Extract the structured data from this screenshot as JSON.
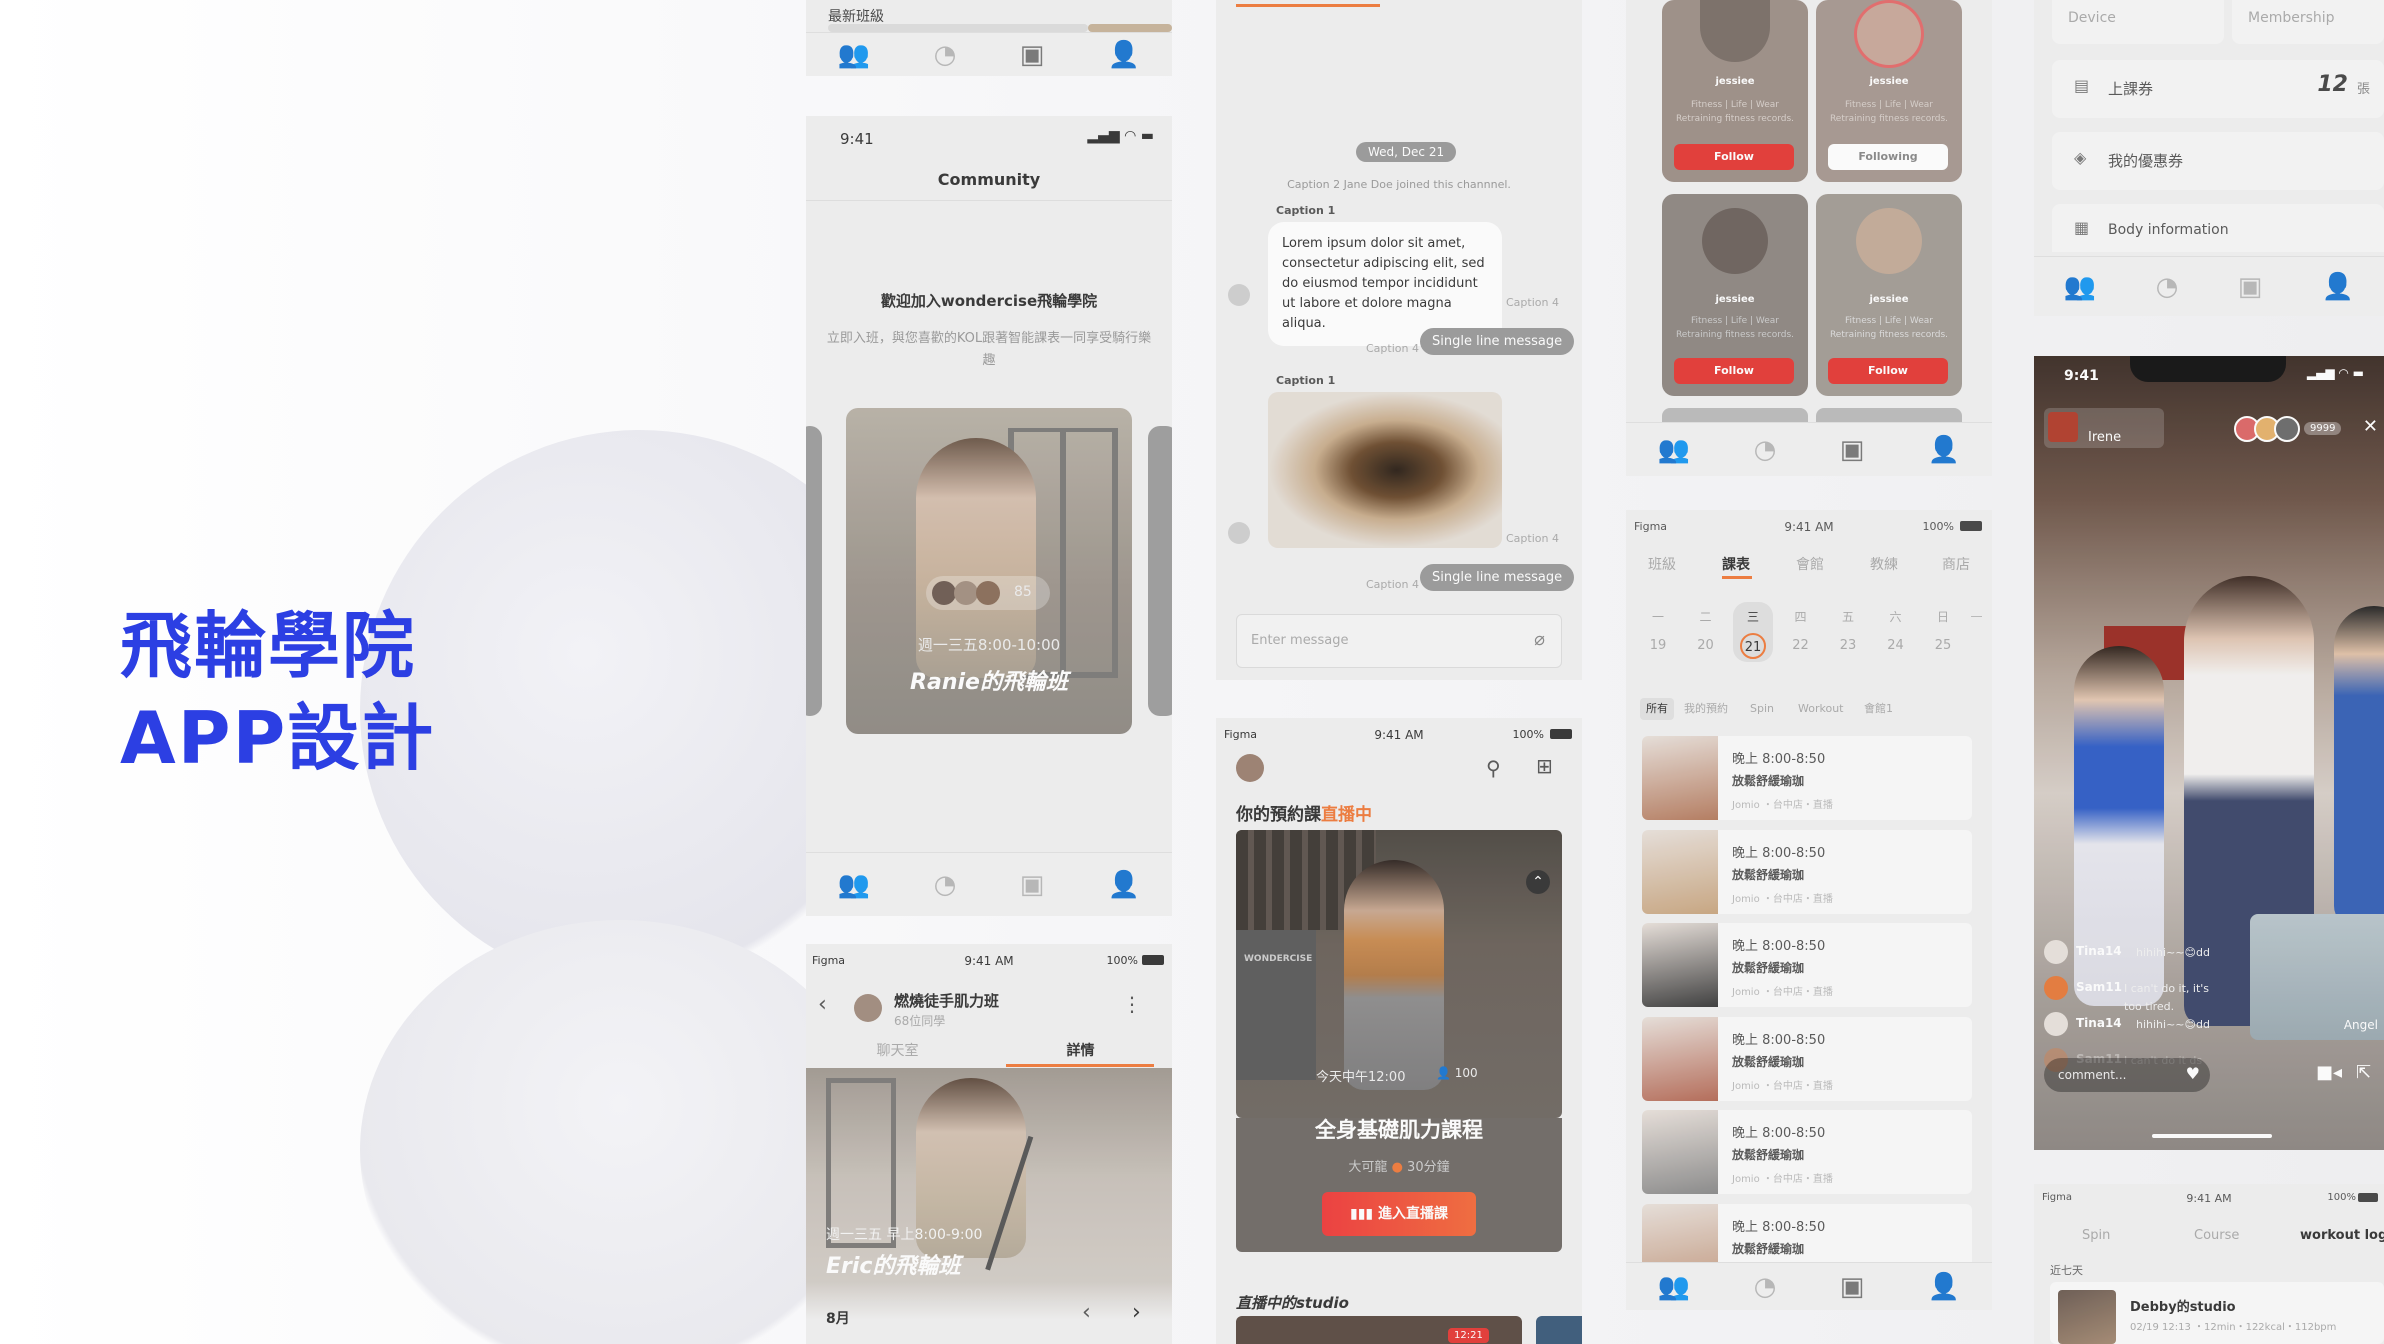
{
  "headline": {
    "line1": "飛輪學院",
    "line2": "APP設計"
  },
  "phone_a": {
    "label": "最新班級"
  },
  "community": {
    "time": "9:41",
    "title": "Community",
    "welcome": "歡迎加入wondercise飛輪學院",
    "desc": "立即入班，與您喜歡的KOL跟著智能課表一同享受騎行樂趣",
    "member_count": "85",
    "schedule": "週一三五8:00-10:00",
    "class_name": "Ranie的飛輪班"
  },
  "class_detail": {
    "carrier": "Figma",
    "time": "9:41 AM",
    "battery": "100%",
    "class_title": "燃燒徒手肌力班",
    "members": "68位同學",
    "tabs": [
      "聊天室",
      "詳情"
    ],
    "schedule": "週一三五 早上8:00-9:00",
    "class_name": "Eric的飛輪班",
    "month": "8月"
  },
  "chat": {
    "date": "Wed, Dec 21",
    "system": "Caption 2 Jane Doe joined this channnel.",
    "caption1": "Caption 1",
    "message": "Lorem ipsum dolor sit amet, consectetur adipiscing elit, sed do eiusmod tempor incididunt ut labore et dolore magna aliqua.",
    "caption4": "Caption 4",
    "single": "Single line message",
    "input_placeholder": "Enter message"
  },
  "live": {
    "carrier": "Figma",
    "time": "9:41 AM",
    "battery": "100%",
    "heading_prefix": "你的預約課",
    "heading_live": "直播中",
    "brand": "WONDERCISE",
    "start": "今天中午12:00",
    "viewers": "100",
    "course": "全身基礎肌力課程",
    "coach": "大可龍",
    "duration": "30分鐘",
    "cta": "進入直播課",
    "section": "直播中的studio",
    "badge": "12:21"
  },
  "coaches": {
    "name": "jessiee",
    "bio": "Fitness | Life | Wear Retraining fitness records.",
    "follow": "Follow",
    "following": "Following"
  },
  "schedule": {
    "carrier": "Figma",
    "time": "9:41 AM",
    "battery": "100%",
    "tabs": [
      "班級",
      "課表",
      "會館",
      "教練",
      "商店"
    ],
    "weekdays": [
      "一",
      "二",
      "三",
      "四",
      "五",
      "六",
      "日",
      "一"
    ],
    "dates": [
      "19",
      "20",
      "21",
      "22",
      "23",
      "24",
      "25"
    ],
    "filters": [
      "所有",
      "我的預約",
      "Spin",
      "Workout",
      "會館1"
    ],
    "item_time": "晚上 8:00-8:50",
    "item_title": "放鬆舒緩瑜珈",
    "item_meta": "Jomio ・台中店・直播"
  },
  "profile": {
    "tabs": [
      "Device",
      "Membership"
    ],
    "tickets_label": "上課券",
    "tickets_count": "12",
    "tickets_unit": "張",
    "coupon": "我的優惠券",
    "body": "Body information"
  },
  "stream": {
    "time": "9:41",
    "host": "Irene",
    "viewers": "9999",
    "comments": [
      {
        "user": "Tina14",
        "text": "hihihi~~😊dd"
      },
      {
        "user": "Sam11",
        "text": "I can't do it, it's too tired."
      },
      {
        "user": "Tina14",
        "text": "hihihi~~😊dd"
      },
      {
        "user": "Sam11",
        "text": "I can't do it ds"
      }
    ],
    "pip_name": "Angel",
    "comment_placeholder": "comment..."
  },
  "logs": {
    "carrier": "Figma",
    "time": "9:41 AM",
    "battery": "100%",
    "tabs": [
      "Spin",
      "Course",
      "workout logs"
    ],
    "period": "近七天",
    "item_title": "Debby的studio",
    "item_meta": "02/19 12:13 ・12min・122kcal・112bpm"
  }
}
